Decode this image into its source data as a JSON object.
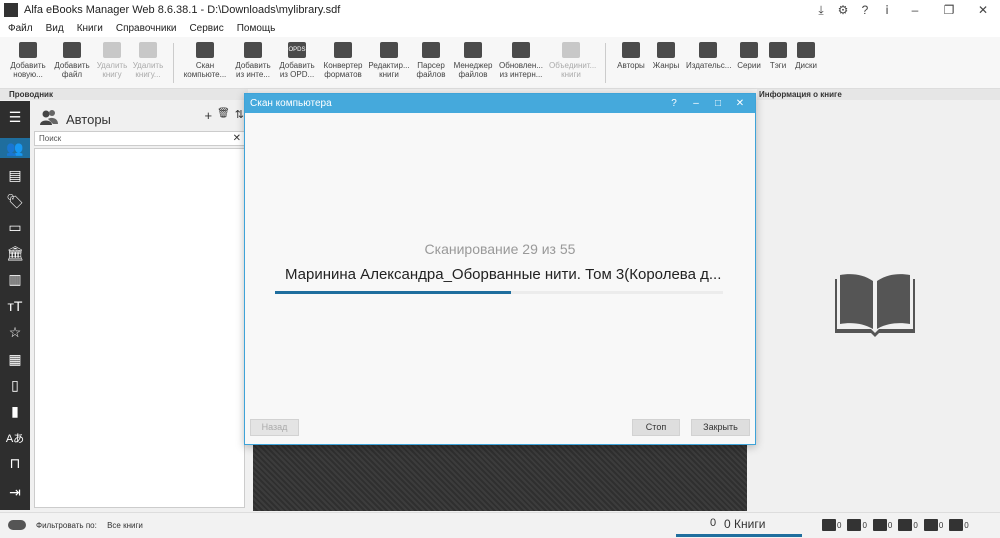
{
  "window": {
    "title": "Alfa eBooks Manager Web 8.6.38.1 - D:\\Downloads\\mylibrary.sdf",
    "controls": [
      "download-icon",
      "gear-icon",
      "help-icon",
      "info-icon",
      "minimize-icon",
      "maximize-icon",
      "close-icon"
    ]
  },
  "menu": [
    "Файл",
    "Вид",
    "Книги",
    "Справочники",
    "Сервис",
    "Помощь"
  ],
  "toolbar": {
    "add_new": "Добавить новую...",
    "add_file": "Добавить файл",
    "delete_book": "Удалить книгу",
    "delete_book2": "Удалить книгу...",
    "scan_computer": "Скан компьюте...",
    "add_from_internet": "Добавить из инте...",
    "add_from_opds": "Добавить из OPD...",
    "opds_badge": "OPDS",
    "converter": "Конвертер форматов",
    "editor": "Редактир... книги",
    "file_parser": "Парсер файлов",
    "file_manager": "Менеджер файлов",
    "update_internet": "Обновлен... из интерн...",
    "merge_books": "Объединит... книги",
    "authors": "Авторы",
    "genres": "Жанры",
    "publishers": "Издательс...",
    "series": "Серии",
    "tags": "Тэги",
    "disks": "Диски"
  },
  "panels": {
    "explorer_header": "Проводник",
    "info_header": "Информация о книге"
  },
  "nav": {
    "title": "Авторы",
    "search_placeholder": "Поиск",
    "actions": [
      "+",
      "🗑",
      "⇅"
    ]
  },
  "dialog": {
    "title": "Скан компьютера",
    "progress_text": "Сканирование 29 из 55",
    "progress_fraction": 0.5273,
    "current_file": "Маринина Александра_Оборванные нити. Том 3(Королева д...",
    "back_button": "Назад",
    "stop_button": "Стоп",
    "close_button": "Закрыть"
  },
  "status": {
    "filter_label": "Фильтровать по:",
    "filter_value": "Все книги",
    "count_number": "0",
    "count_label": "0 Книги",
    "stats": [
      "0",
      "0",
      "0",
      "0",
      "0",
      "0"
    ]
  },
  "colors": {
    "accent": "#1f6e9e",
    "dialog_title": "#45a9dc",
    "sidebar": "#2e2e2e"
  }
}
